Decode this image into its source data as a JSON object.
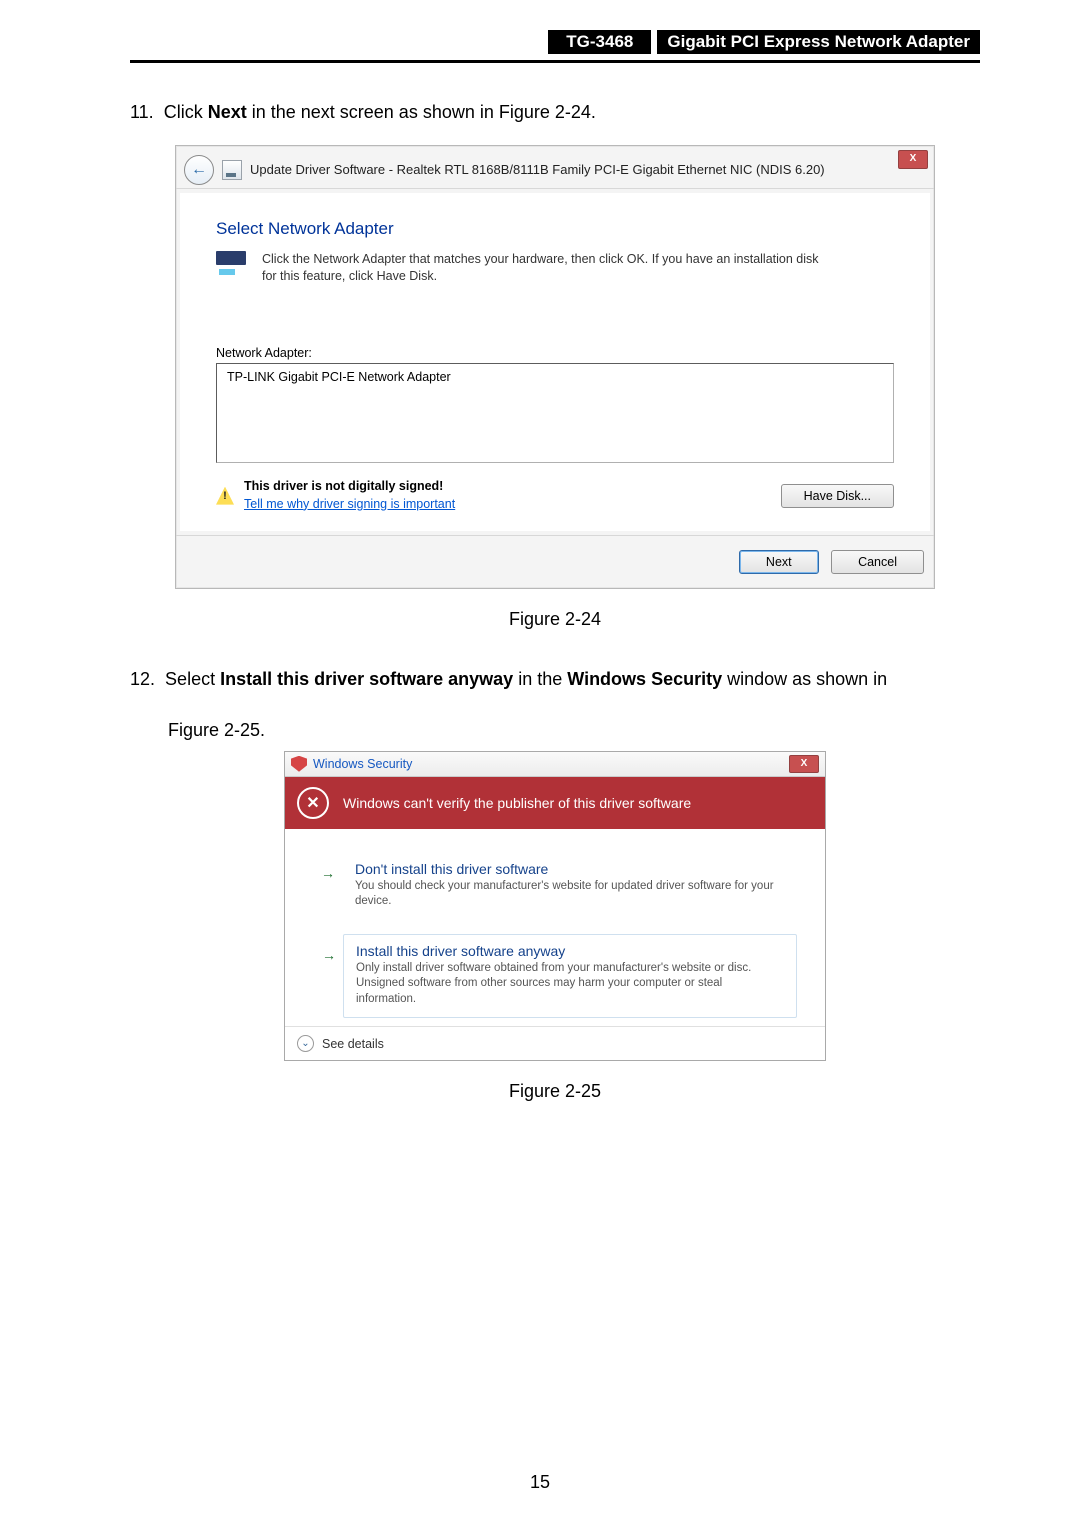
{
  "header": {
    "model": "TG-3468",
    "product": "Gigabit PCI Express Network Adapter"
  },
  "steps": {
    "s11_num": "11.",
    "s11_a": "Click ",
    "s11_b": "Next",
    "s11_c": " in the next screen as shown in Figure 2-24.",
    "s12_num": "12.",
    "s12_a": "Select ",
    "s12_b": "Install this driver software anyway",
    "s12_c": " in the ",
    "s12_d": "Windows Security",
    "s12_e": " window as shown in",
    "s12_line2": "Figure 2-25."
  },
  "fig1_caption": "Figure 2-24",
  "fig2_caption": "Figure 2-25",
  "dlg1": {
    "title": "Update Driver Software -  Realtek RTL 8168B/8111B Family PCI-E Gigabit Ethernet NIC (NDIS 6.20)",
    "heading": "Select Network Adapter",
    "desc": "Click the Network Adapter that matches your hardware, then click OK. If you have an installation disk for this feature, click Have Disk.",
    "list_label": "Network Adapter:",
    "list_item": "TP-LINK Gigabit PCI-E Network Adapter",
    "warn": "This driver is not digitally signed!",
    "warn_link": "Tell me why driver signing is important",
    "have_disk": "Have Disk...",
    "next": "Next",
    "cancel": "Cancel",
    "close_x": "X"
  },
  "dlg2": {
    "title": "Windows Security",
    "close_x": "X",
    "banner": "Windows can't verify the publisher of this driver software",
    "x_glyph": "✕",
    "opt1_title": "Don't install this driver software",
    "opt1_desc": "You should check your manufacturer's website for updated driver software for your device.",
    "opt2_title": "Install this driver software anyway",
    "opt2_desc": "Only install driver software obtained from your manufacturer's website or disc. Unsigned software from other sources may harm your computer or steal information.",
    "see_details": "See details",
    "arrow": "→",
    "chev": "⌄"
  },
  "page_number": "15"
}
